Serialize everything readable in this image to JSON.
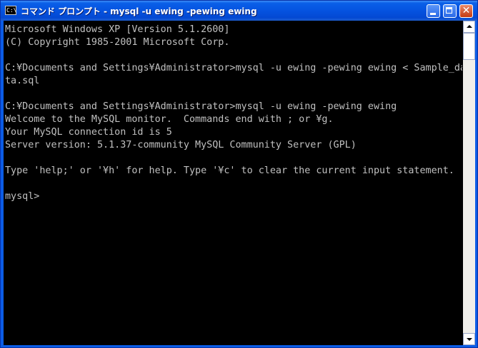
{
  "window": {
    "icon_text": "C:\\",
    "title": "コマンド プロンプト - mysql -u ewing -pewing ewing"
  },
  "console": {
    "lines": [
      "Microsoft Windows XP [Version 5.1.2600]",
      "(C) Copyright 1985-2001 Microsoft Corp.",
      "",
      "C:¥Documents and Settings¥Administrator>mysql -u ewing -pewing ewing < Sample_da",
      "ta.sql",
      "",
      "C:¥Documents and Settings¥Administrator>mysql -u ewing -pewing ewing",
      "Welcome to the MySQL monitor.  Commands end with ; or ¥g.",
      "Your MySQL connection id is 5",
      "Server version: 5.1.37-community MySQL Community Server (GPL)",
      "",
      "Type 'help;' or '¥h' for help. Type '¥c' to clear the current input statement.",
      "",
      "mysql>"
    ]
  },
  "colors": {
    "console_bg": "#000000",
    "console_fg": "#c0c0c0",
    "titlebar": "#0553e0"
  },
  "icons": {
    "system": "console-icon",
    "minimize": "minimize-icon",
    "maximize": "maximize-icon",
    "close": "close-icon",
    "scroll_up": "scroll-up-arrow-icon",
    "scroll_down": "scroll-down-arrow-icon"
  }
}
